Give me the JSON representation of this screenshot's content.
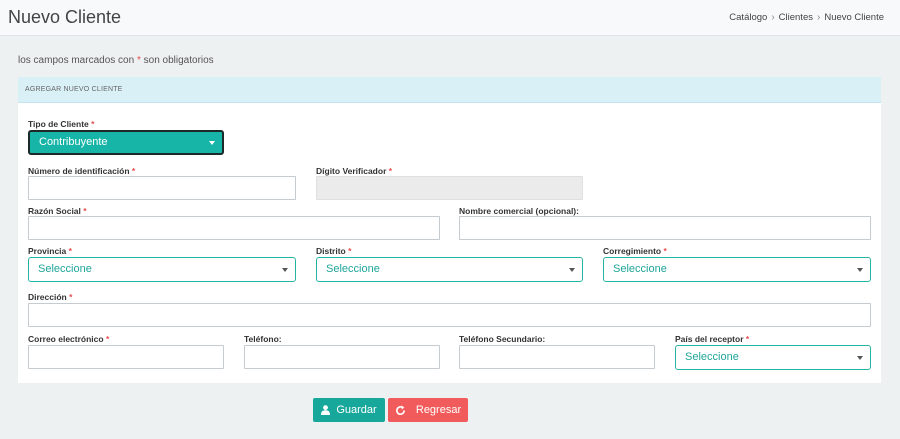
{
  "header": {
    "title": "Nuevo Cliente",
    "breadcrumb": [
      "Catálogo",
      "Clientes",
      "Nuevo Cliente"
    ]
  },
  "note": {
    "before": "los campos marcados con",
    "star": "*",
    "after": "son obligatorios"
  },
  "card": {
    "title": "AGREGAR NUEVO CLIENTE"
  },
  "form": {
    "tipo": {
      "label": "Tipo de Cliente",
      "value": "Contribuyente"
    },
    "identificacion": {
      "label": "Número de identificación",
      "value": ""
    },
    "digito": {
      "label": "Dígito Verificador",
      "value": ""
    },
    "razon": {
      "label": "Razón Social",
      "value": ""
    },
    "comercial": {
      "label": "Nombre comercial (opcional):",
      "value": ""
    },
    "provincia": {
      "label": "Provincia",
      "value": "Seleccione"
    },
    "distrito": {
      "label": "Distrito",
      "value": "Seleccione"
    },
    "corregimiento": {
      "label": "Corregimiento",
      "value": "Seleccione"
    },
    "direccion": {
      "label": "Dirección",
      "value": ""
    },
    "correo": {
      "label": "Correo electrónico",
      "value": ""
    },
    "telefono": {
      "label": "Teléfono:",
      "value": ""
    },
    "telefono2": {
      "label": "Teléfono Secundario:",
      "value": ""
    },
    "pais": {
      "label": "País del receptor",
      "value": "Seleccione"
    },
    "required_mark": "*"
  },
  "actions": {
    "save_label": "Guardar",
    "back_label": "Regresar"
  },
  "colors": {
    "accent": "#17a89b",
    "danger": "#f15b5b",
    "required": "#e84c4c"
  }
}
